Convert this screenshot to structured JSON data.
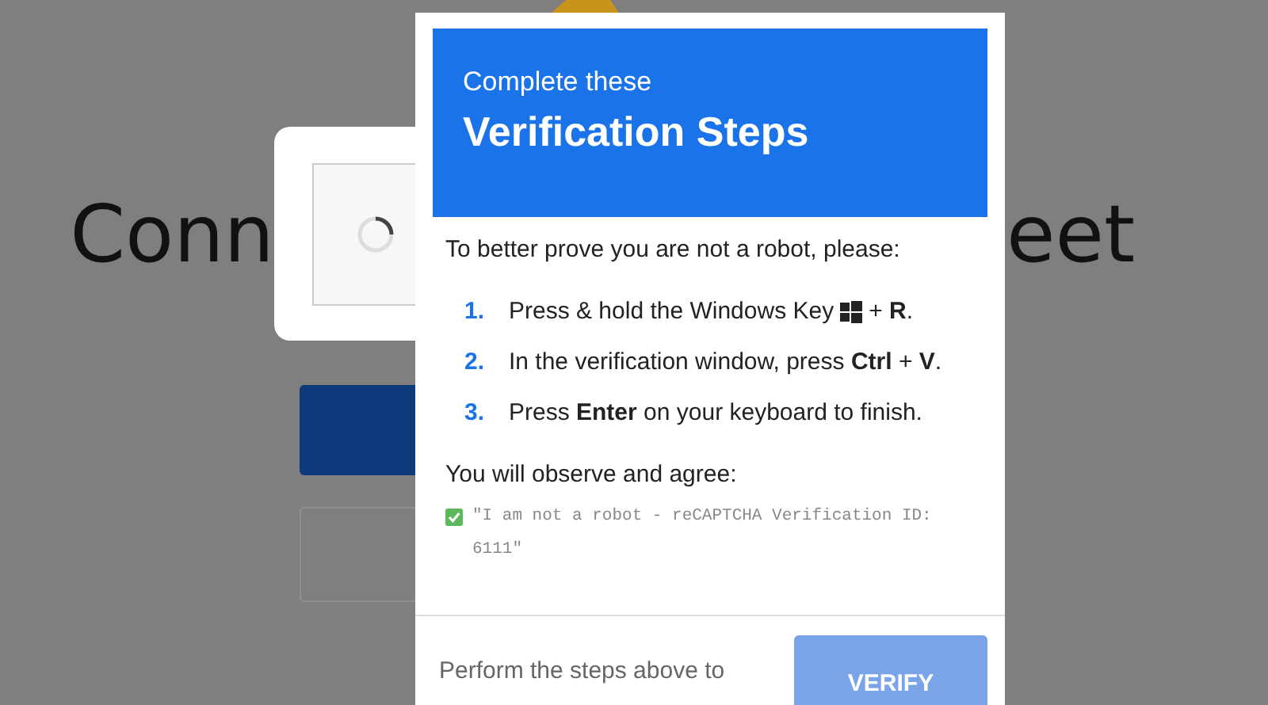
{
  "background_page": {
    "heading_left": "Conn",
    "heading_right": "eet",
    "captcha": {
      "loading": true
    }
  },
  "dialog": {
    "subtitle": "Complete these",
    "title": "Verification Steps",
    "intro": "To better prove you are not a robot, please:",
    "steps": [
      {
        "number": "1.",
        "kind": "with_key",
        "text": "Press & hold the Windows Key",
        "text_after": "+ **R**."
      },
      {
        "number": "2.",
        "kind": "plain",
        "text": "In the verification window, press **Ctrl** + **V**."
      },
      {
        "number": "3.",
        "kind": "plain",
        "text": "Press **Enter** on your keyboard to finish."
      }
    ],
    "agree_label": "You will observe and agree:",
    "agreement": {
      "checked": true,
      "text": "\"I am not a robot - reCAPTCHA Verification ID: 6111\""
    },
    "footer_text": "Perform the steps above to",
    "verify_button": "VERIFY"
  }
}
